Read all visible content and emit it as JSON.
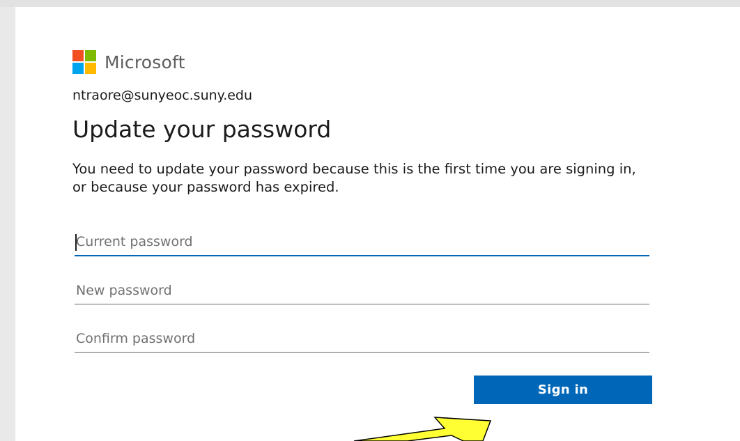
{
  "brand": {
    "name": "Microsoft",
    "logo_colors": [
      "#f25022",
      "#7fba00",
      "#00a4ef",
      "#ffb900"
    ]
  },
  "account_email": "ntraore@sunyeoc.suny.edu",
  "title": "Update your password",
  "description": "You need to update your password because this is the first time you are signing in, or because your password has expired.",
  "fields": {
    "current_password": {
      "placeholder": "Current password",
      "value": ""
    },
    "new_password": {
      "placeholder": "New password",
      "value": ""
    },
    "confirm_password": {
      "placeholder": "Confirm password",
      "value": ""
    }
  },
  "sign_in_label": "Sign in",
  "colors": {
    "accent": "#0067b8",
    "annotation_arrow": "#ffff33"
  },
  "annotation": {
    "icon": "arrow-pointer-icon",
    "points_to": "sign-in-button"
  }
}
